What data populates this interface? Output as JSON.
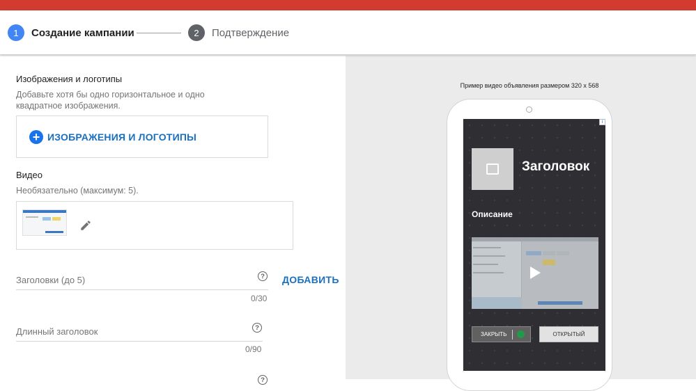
{
  "stepper": {
    "steps": [
      {
        "number": "1",
        "label": "Создание кампании"
      },
      {
        "number": "2",
        "label": "Подтверждение"
      }
    ]
  },
  "images": {
    "title": "Изображения и логотипы",
    "help": "Добавьте хотя бы одно горизонтальное и одно квадратное изображения.",
    "button_label": "ИЗОБРАЖЕНИЯ И ЛОГОТИПЫ"
  },
  "video": {
    "title": "Видео",
    "help": "Необязательно (максимум: 5)."
  },
  "headlines": {
    "placeholder": "Заголовки (до 5)",
    "counter": "0/30",
    "add_label": "ДОБАВИТЬ"
  },
  "long_headline": {
    "placeholder": "Длинный заголовок",
    "counter": "0/90"
  },
  "preview": {
    "caption": "Пример видео объявления размером 320 x 568",
    "ad": {
      "title": "Заголовок",
      "description": "Описание",
      "close_label": "ЗАКРЫТЬ",
      "open_label": "ОТКРЫТЫЙ"
    }
  },
  "colors": {
    "topbar": "#d23b2e",
    "step_active": "#4285f4",
    "step_inactive": "#5f6368",
    "link": "#1a6fbf",
    "preview_bg": "#ebebeb",
    "ad_bg": "#2f2f33"
  }
}
